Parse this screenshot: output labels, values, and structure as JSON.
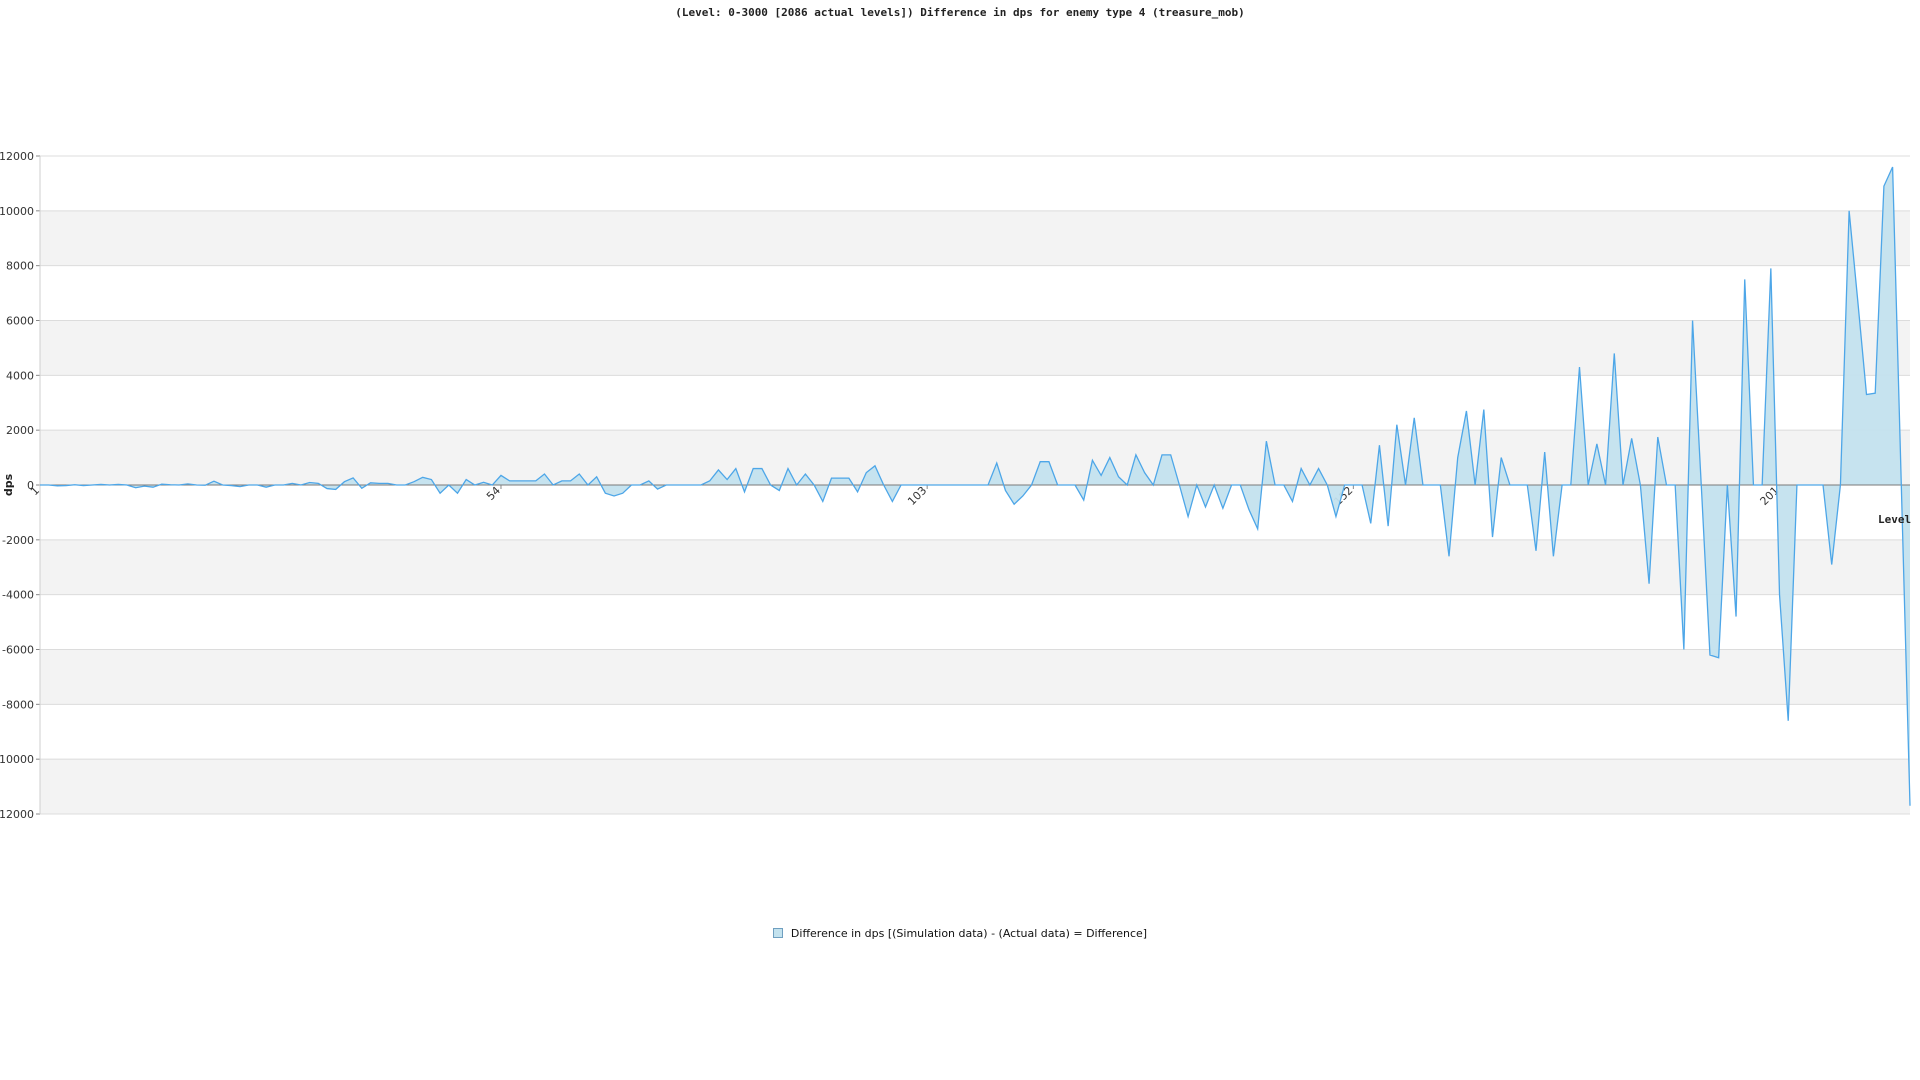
{
  "chart_data": {
    "type": "area",
    "title": "(Level: 0-3000 [2086 actual levels]) Difference in dps for enemy type 4 (treasure_mob)",
    "xlabel": "Level",
    "ylabel": "dps",
    "ylim": [
      -12000,
      12000
    ],
    "yticks": [
      -12000,
      -10000,
      -8000,
      -6000,
      -4000,
      -2000,
      0,
      2000,
      4000,
      6000,
      8000,
      10000,
      12000
    ],
    "xtick_labels": [
      {
        "index": 0,
        "label": "1"
      },
      {
        "index": 53,
        "label": "54"
      },
      {
        "index": 102,
        "label": "103"
      },
      {
        "index": 151,
        "label": "152"
      },
      {
        "index": 200,
        "label": "201"
      }
    ],
    "grid": true,
    "legend_position": "bottom-center",
    "series": [
      {
        "name": "Difference in dps [(Simulation data) - (Actual data) = Difference]",
        "color": "#4da6e8",
        "fill": "#c3e2ee",
        "values": [
          0,
          0,
          -30,
          -20,
          10,
          -20,
          0,
          20,
          0,
          20,
          0,
          -100,
          -40,
          -80,
          30,
          10,
          0,
          40,
          0,
          -10,
          140,
          0,
          -20,
          -60,
          0,
          0,
          -80,
          0,
          0,
          60,
          0,
          90,
          60,
          -130,
          -160,
          120,
          260,
          -120,
          80,
          60,
          60,
          0,
          0,
          120,
          280,
          200,
          -300,
          0,
          -300,
          200,
          0,
          100,
          0,
          350,
          150,
          150,
          150,
          150,
          400,
          0,
          150,
          150,
          400,
          0,
          300,
          -300,
          -400,
          -300,
          0,
          0,
          150,
          -150,
          0,
          0,
          0,
          0,
          0,
          150,
          550,
          200,
          600,
          -250,
          600,
          600,
          0,
          -200,
          600,
          0,
          400,
          0,
          -600,
          250,
          250,
          250,
          -250,
          450,
          700,
          0,
          -600,
          0,
          0,
          0,
          0,
          0,
          0,
          0,
          0,
          0,
          0,
          0,
          800,
          -200,
          -700,
          -400,
          0,
          850,
          850,
          0,
          0,
          0,
          -550,
          900,
          350,
          1000,
          300,
          0,
          1100,
          450,
          0,
          1100,
          1100,
          0,
          -1150,
          0,
          -800,
          0,
          -850,
          0,
          0,
          -900,
          -1600,
          1600,
          0,
          0,
          -600,
          600,
          0,
          600,
          0,
          -1150,
          0,
          0,
          0,
          -1400,
          1450,
          -1500,
          2200,
          0,
          2450,
          0,
          0,
          0,
          -2600,
          1000,
          2700,
          0,
          2750,
          -1900,
          1000,
          0,
          0,
          0,
          -2400,
          1200,
          -2600,
          0,
          0,
          4300,
          0,
          1500,
          0,
          4800,
          0,
          1700,
          0,
          -3600,
          1750,
          0,
          0,
          -6000,
          6000,
          0,
          -6200,
          -6300,
          0,
          -4800,
          7500,
          0,
          0,
          7900,
          -4000,
          -8600,
          0,
          0,
          0,
          0,
          -2900,
          0,
          10000,
          6700,
          3300,
          3350,
          10900,
          11600,
          0,
          -11700
        ]
      }
    ]
  },
  "legend": {
    "label": "Difference in dps [(Simulation data) - (Actual data) = Difference]"
  }
}
